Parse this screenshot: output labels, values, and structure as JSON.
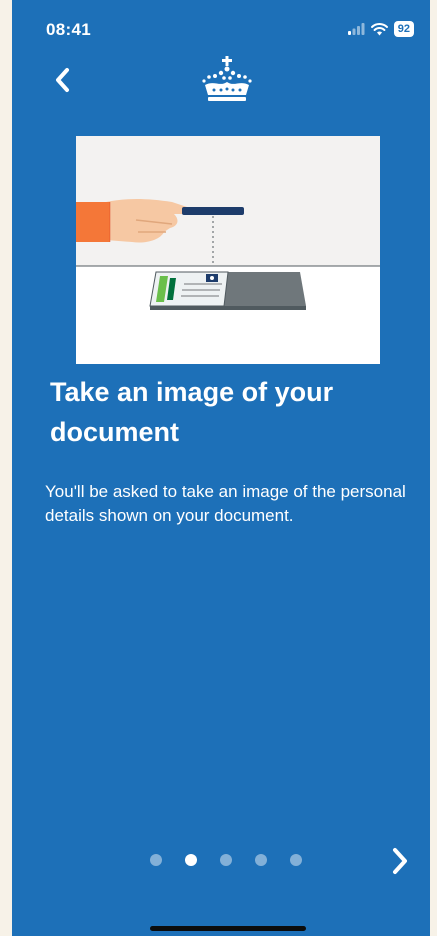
{
  "status_bar": {
    "time": "08:41",
    "battery": "92",
    "icons": [
      "signal-icon",
      "wifi-icon",
      "battery-icon"
    ]
  },
  "header": {
    "back_icon": "chevron-left-icon",
    "logo": "crown-icon"
  },
  "content": {
    "illustration": "hand-scanning-document-illustration",
    "heading": "Take an image of your document",
    "body": "You'll be asked to take an image of the personal details shown on your document."
  },
  "pager": {
    "count": 5,
    "active_index": 1
  },
  "footer": {
    "next_icon": "chevron-right-icon"
  },
  "colors": {
    "background": "#1d70b8",
    "text": "#ffffff",
    "page_margin": "#f7f2e8"
  }
}
